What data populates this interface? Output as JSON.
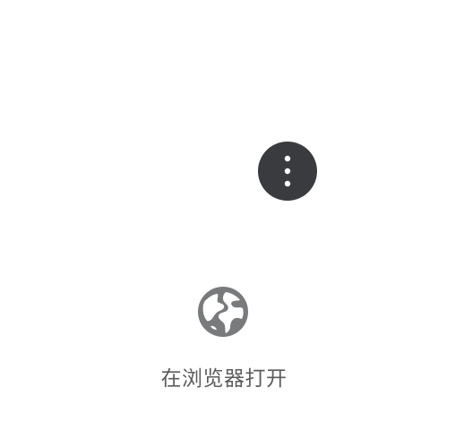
{
  "menu": {
    "more_icon": "more-vertical-icon"
  },
  "actions": {
    "open_in_browser": {
      "icon": "globe-icon",
      "label": "在浏览器打开"
    }
  },
  "colors": {
    "more_button_bg": "#3a3b3f",
    "globe_icon": "#787a7c",
    "label_text": "#5c5c5c",
    "background": "#ffffff"
  }
}
